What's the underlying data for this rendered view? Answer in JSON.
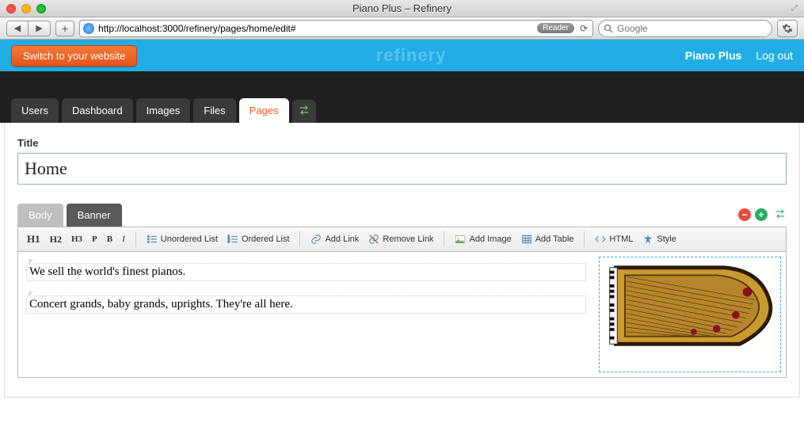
{
  "window": {
    "title": "Piano Plus – Refinery"
  },
  "browser": {
    "url": "http://localhost:3000/refinery/pages/home/edit#",
    "reader_label": "Reader",
    "search_placeholder": "Google"
  },
  "header": {
    "switch_button": "Switch to your website",
    "logo": "refinery",
    "site_name": "Piano Plus",
    "logout": "Log out"
  },
  "nav_tabs": {
    "users": "Users",
    "dashboard": "Dashboard",
    "images": "Images",
    "files": "Files",
    "pages": "Pages"
  },
  "form": {
    "title_label": "Title",
    "title_value": "Home"
  },
  "part_tabs": {
    "body": "Body",
    "banner": "Banner"
  },
  "toolbar": {
    "h1": "H1",
    "h2": "H2",
    "h3": "H3",
    "p": "P",
    "b": "B",
    "i": "I",
    "ul": "Unordered List",
    "ol": "Ordered List",
    "add_link": "Add Link",
    "remove_link": "Remove Link",
    "add_image": "Add Image",
    "add_table": "Add Table",
    "html": "HTML",
    "style": "Style"
  },
  "editor": {
    "p1": "We sell the world's finest pianos.",
    "p2": "Concert grands, baby grands, uprights. They're all here."
  }
}
